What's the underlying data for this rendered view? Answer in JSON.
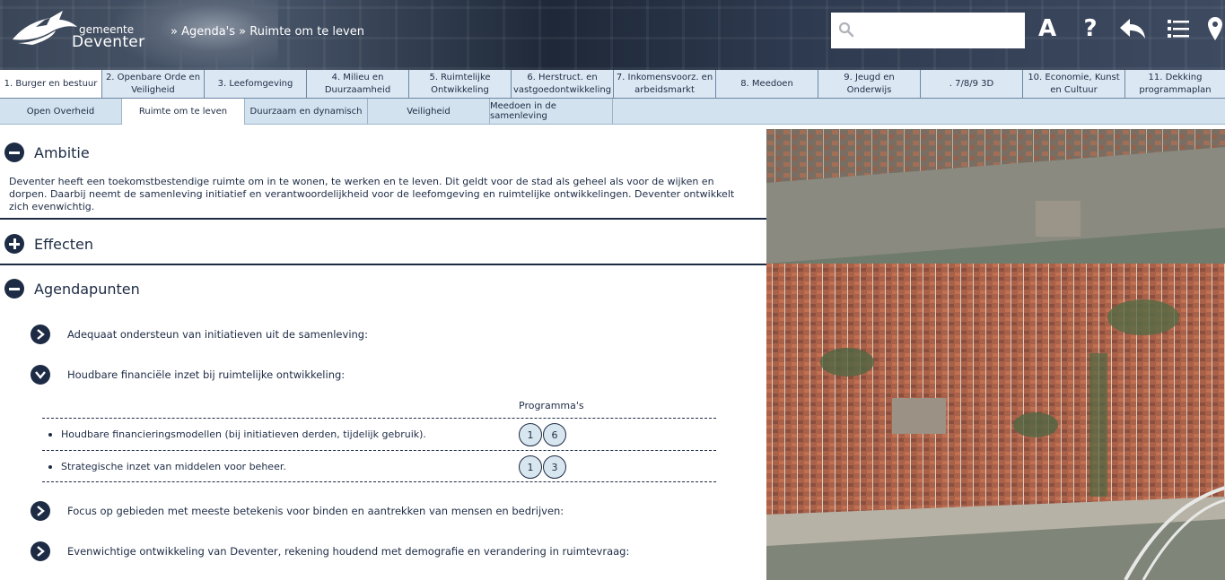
{
  "header": {
    "logo_small": "gemeente",
    "logo_big": "Deventer",
    "breadcrumb": "» Agenda's » Ruimte om te leven",
    "search_placeholder": "",
    "icons": [
      "search-icon",
      "font-size-icon",
      "help-icon",
      "back-icon",
      "list-icon",
      "map-marker-icon"
    ],
    "font_icon_label": "A",
    "help_icon_label": "?"
  },
  "main_nav": [
    "1. Burger en bestuur",
    "2. Openbare Orde en Veiligheid",
    "3. Leefomgeving",
    "4. Milieu en Duurzaamheid",
    "5. Ruimtelijke Ontwikkeling",
    "6. Herstruct. en vastgoedontwikkeling",
    "7. Inkomensvoorz. en arbeidsmarkt",
    "8. Meedoen",
    "9. Jeugd en Onderwijs",
    ". 7/8/9 3D",
    "10. Economie, Kunst en Cultuur",
    "11. Dekking programmaplan"
  ],
  "sub_nav": [
    {
      "label": "Open Overheid",
      "active": false
    },
    {
      "label": "Ruimte om te leven",
      "active": true
    },
    {
      "label": "Duurzaam en dynamisch",
      "active": false
    },
    {
      "label": "Veiligheid",
      "active": false
    },
    {
      "label": "Meedoen in de samenleving",
      "active": false
    }
  ],
  "sections": {
    "ambitie": {
      "title": "Ambitie",
      "text": "Deventer heeft een toekomstbestendige ruimte om in te wonen, te werken en te leven. Dit geldt voor de stad als geheel als voor de wijken en dorpen. Daarbij neemt de samenleving initiatief en verantwoordelijkheid voor de leefomgeving en ruimtelijke ontwikkelingen. Deventer ontwikkelt zich evenwichtig."
    },
    "effecten": {
      "title": "Effecten"
    },
    "agendapunten": {
      "title": "Agendapunten",
      "items": [
        "Adequaat ondersteun van initiatieven uit de samenleving:",
        "Houdbare financiële inzet bij ruimtelijke ontwikkeling:",
        "Focus op gebieden met meeste betekenis voor binden en aantrekken van mensen en bedrijven:",
        "Evenwichtige ontwikkeling van Deventer, rekening houdend met demografie en verandering in ruimtevraag:"
      ],
      "table": {
        "header": "Programma's",
        "rows": [
          {
            "text": "Houdbare financieringsmodellen (bij initiatieven derden, tijdelijk gebruik).",
            "programs": [
              "1",
              "6"
            ]
          },
          {
            "text": "Strategische inzet van middelen voor beheer.",
            "programs": [
              "1",
              "3"
            ]
          }
        ]
      }
    }
  },
  "colors": {
    "navy": "#1d2b44",
    "nav_bg": "#dbe8f3",
    "badge_bg": "#d8e6f0"
  }
}
